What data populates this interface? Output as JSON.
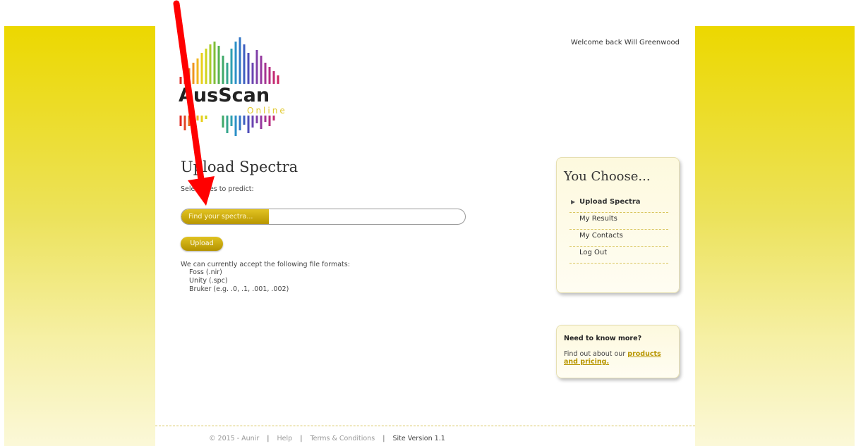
{
  "header": {
    "welcome": "Welcome back Will Greenwood"
  },
  "logo": {
    "name": "AusScan",
    "sub": "Online"
  },
  "main": {
    "title": "Upload Spectra",
    "select_label": "Select files to predict:",
    "file_button": "Find your spectra...",
    "upload_button": "Upload",
    "formats_intro": "We can currently accept the following file formats:",
    "formats": [
      "Foss (.nir)",
      "Unity (.spc)",
      "Bruker (e.g. .0, .1, .001, .002)"
    ]
  },
  "sidebar": {
    "title": "You Choose...",
    "items": [
      {
        "label": "Upload Spectra",
        "active": true
      },
      {
        "label": "My Results"
      },
      {
        "label": "My Contacts"
      },
      {
        "label": "Log Out"
      }
    ]
  },
  "info_box": {
    "title": "Need to know more?",
    "text": "Find out about our",
    "link": "products and pricing."
  },
  "footer": {
    "copyright": "© 2015 - Aunir",
    "links": [
      "Help",
      "Terms & Conditions"
    ],
    "version": "Site Version 1.1"
  },
  "colors": {
    "accent": "#c9a800",
    "background": "#ecd800",
    "arrow": "#ff0000"
  },
  "annotations": {
    "arrow": "red-arrow-pointer"
  }
}
